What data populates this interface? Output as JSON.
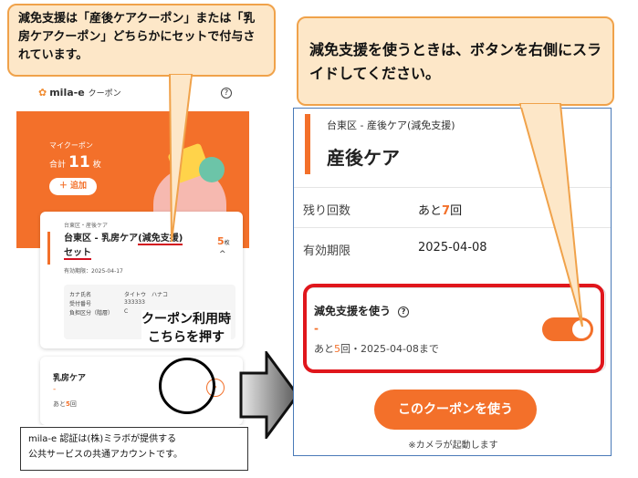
{
  "left_app": {
    "logo_name": "mila-e",
    "logo_sub": "クーポン",
    "help_glyph": "?",
    "my_coupon_label": "マイクーポン",
    "total_label": "合計",
    "total_count": "11",
    "total_unit": "枚",
    "add_button": "＋ 追加",
    "card": {
      "subtitle": "台東区・産後ケア",
      "title_plain": "台東区 - 乳房ケア",
      "title_underlined": "(減免支援)",
      "title_suffix": "セット",
      "count": "5",
      "count_unit": "枚",
      "chevron": "^",
      "expiry": "有効期限：2025-04-17",
      "info": [
        {
          "key": "カナ氏名",
          "value": "タイトウ　ハナコ"
        },
        {
          "key": "受付番号",
          "value": "333333"
        },
        {
          "key": "負担区分（階層）",
          "value": "C"
        }
      ]
    },
    "card2": {
      "title": "乳房ケア",
      "dash": "-",
      "remaining_prefix": "あと",
      "remaining_count": "5",
      "remaining_suffix": "回",
      "arrow": "›"
    }
  },
  "callouts": {
    "left": "減免支援は「産後ケアクーポン」または「乳房ケアクーポン」どちらかにセットで付与されています。",
    "right": "減免支援を使うときは、ボタンを右側にスライドしてください。",
    "push_line1": "クーポン利用時",
    "push_line2": "こちらを押す"
  },
  "footnote": {
    "line1": "mila-e 認証は(株)ミラボが提供する",
    "line2": "公共サービスの共通アカウントです。"
  },
  "right_app": {
    "subtitle": "台東区 - 産後ケア(減免支援)",
    "title": "産後ケア",
    "rows": [
      {
        "key": "残り回数",
        "value_prefix": "あと",
        "value_num": "7",
        "value_suffix": "回"
      },
      {
        "key": "有効期限",
        "value": "2025-04-08"
      }
    ],
    "switch_label": "減免支援を使う",
    "switch_help": "?",
    "switch_dash": "-",
    "switch_meta_prefix": "あと",
    "switch_meta_num": "5",
    "switch_meta_suffix": "回・2025-04-08まで",
    "toggle_on": true,
    "use_button": "このクーポンを使う",
    "camera_note": "※カメラが起動します"
  },
  "colors": {
    "accent": "#f3702a",
    "highlight_red": "#e0161c",
    "callout_bg": "#fde7c8",
    "callout_border": "#f0a24a"
  }
}
